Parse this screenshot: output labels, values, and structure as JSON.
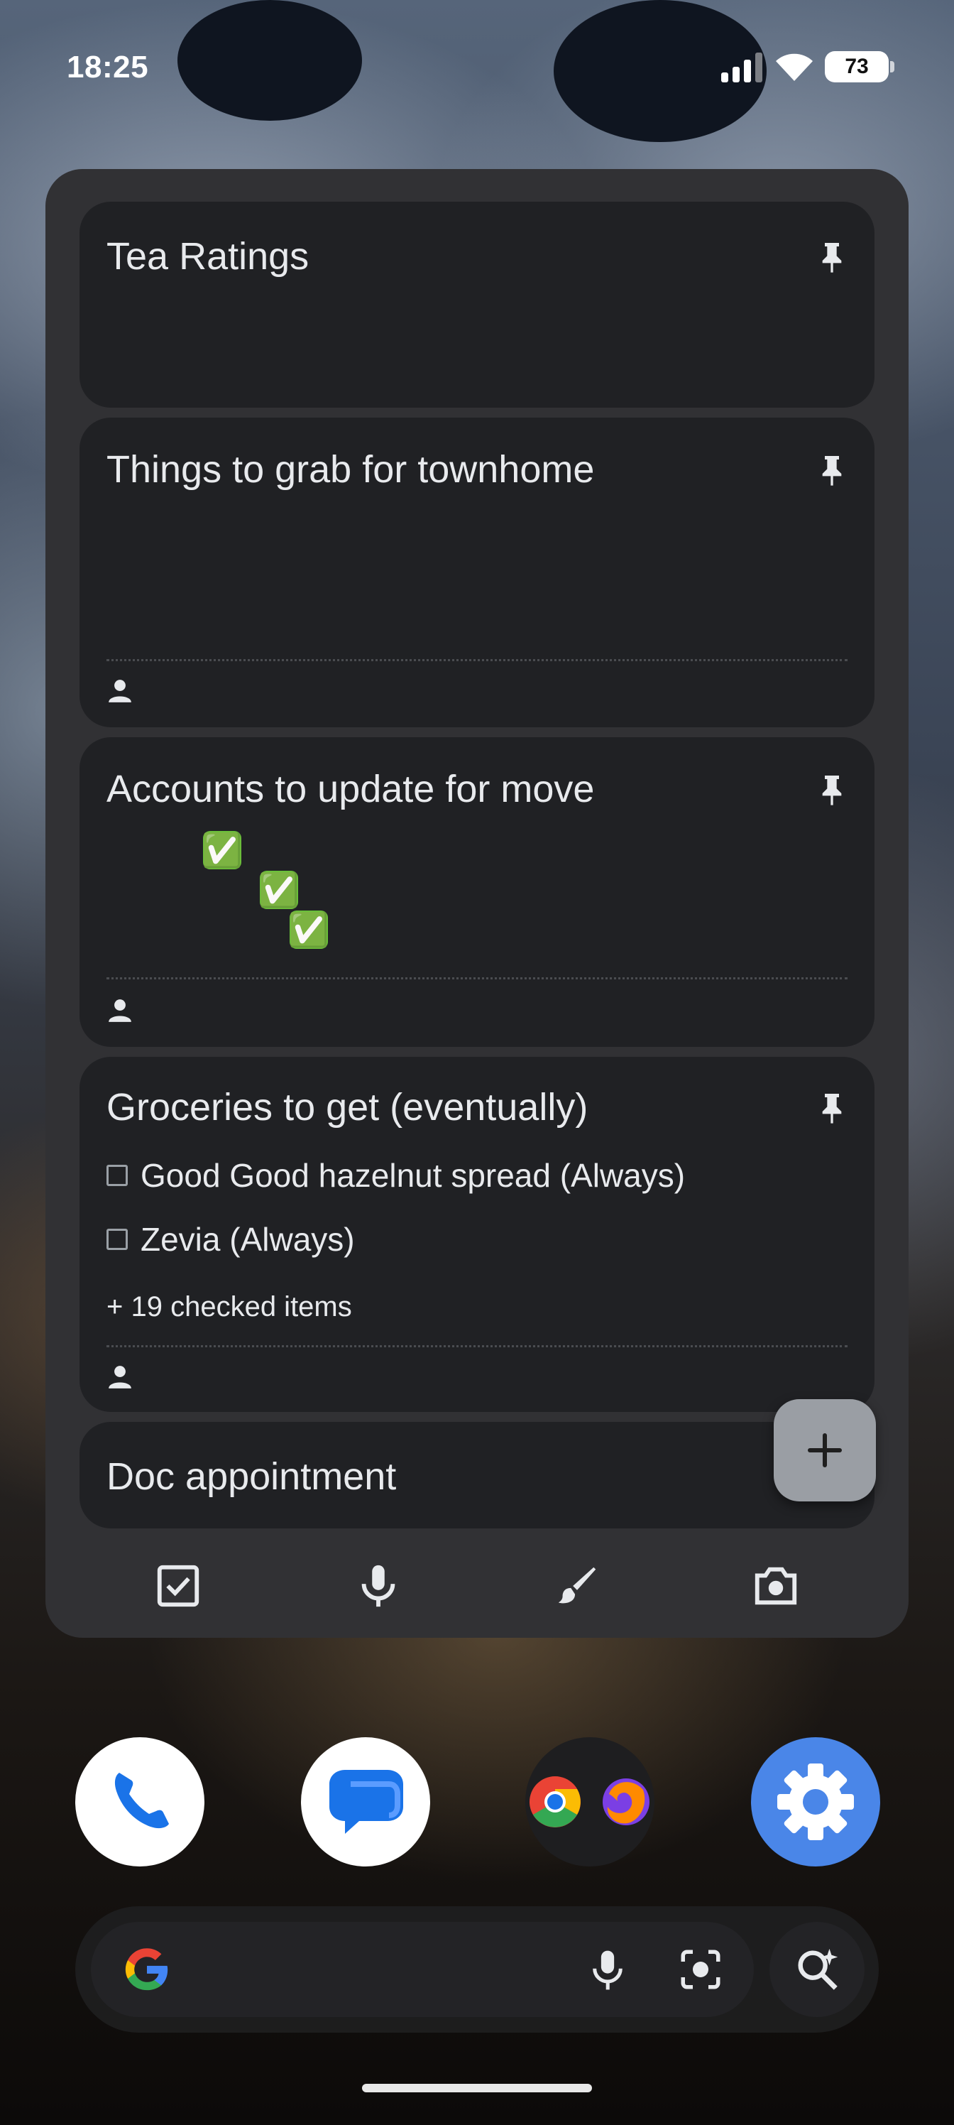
{
  "status_bar": {
    "time": "18:25",
    "battery_level": "73"
  },
  "notes": [
    {
      "title": "Tea Ratings",
      "pinned": true,
      "shared": false
    },
    {
      "title": "Things to grab for townhome",
      "pinned": true,
      "shared": true
    },
    {
      "title": "Accounts to update for move",
      "pinned": true,
      "shared": true,
      "content": [
        "✅",
        "✅",
        "✅"
      ]
    },
    {
      "title": "Groceries to get (eventually)",
      "pinned": true,
      "shared": true,
      "items": [
        "Good Good hazelnut spread (Always)",
        "Zevia (Always)"
      ],
      "checked_summary": "+ 19 checked items"
    },
    {
      "title": "Doc appointment",
      "pinned": false,
      "shared": false
    }
  ],
  "toolbar": {
    "icons": [
      "checkbox-icon",
      "microphone-icon",
      "brush-icon",
      "camera-icon"
    ]
  },
  "fab": {
    "icon": "plus-icon"
  },
  "dock": {
    "apps": [
      "phone-app",
      "messages-app",
      "chrome-app",
      "firefox-app",
      "settings-app"
    ]
  },
  "search_bar": {
    "icons": [
      "google-logo",
      "microphone-icon",
      "lens-icon",
      "ai-search-icon"
    ]
  },
  "colors": {
    "widget_bg": "#313134",
    "note_bg": "#202124",
    "text": "#e8eaed",
    "fab_bg": "#9a9ea4",
    "settings_blue": "#4a86e8"
  }
}
